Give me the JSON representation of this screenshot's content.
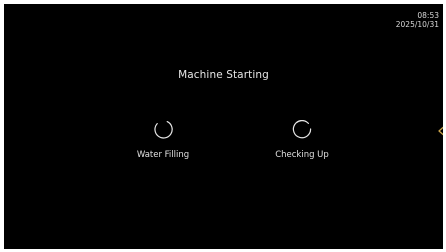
{
  "status": {
    "time": "08:53",
    "date": "2025/10/31"
  },
  "screen": {
    "title": "Machine Starting"
  },
  "tasks": [
    {
      "label": "Water Filling",
      "icon": "loading-spinner-icon"
    },
    {
      "label": "Checking Up",
      "icon": "loading-spinner-icon"
    }
  ],
  "side": {
    "icon": "chevron-left-icon"
  },
  "colors": {
    "background": "#000000",
    "text": "#e6e6e6",
    "accent": "#c9a24a"
  }
}
